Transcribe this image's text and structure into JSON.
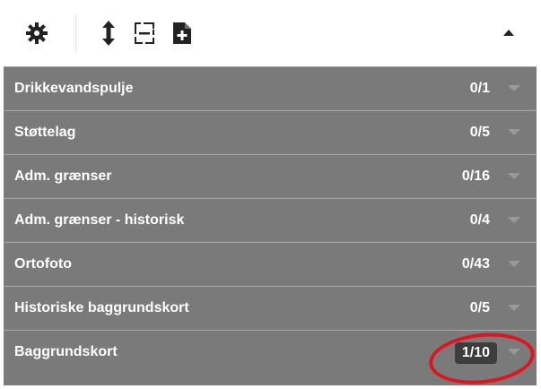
{
  "toolbar": {
    "icons": [
      "gear-icon",
      "expand-vertical-icon",
      "collapse-frame-icon",
      "add-document-icon",
      "chevron-up-icon"
    ]
  },
  "layers": [
    {
      "name": "Drikkevandspulje",
      "count": "0/1",
      "highlighted": false
    },
    {
      "name": "Støttelag",
      "count": "0/5",
      "highlighted": false
    },
    {
      "name": "Adm. grænser",
      "count": "0/16",
      "highlighted": false
    },
    {
      "name": "Adm. grænser - historisk",
      "count": "0/4",
      "highlighted": false
    },
    {
      "name": "Ortofoto",
      "count": "0/43",
      "highlighted": false
    },
    {
      "name": "Historiske baggrundskort",
      "count": "0/5",
      "highlighted": false
    },
    {
      "name": "Baggrundskort",
      "count": "1/10",
      "highlighted": true
    }
  ],
  "colors": {
    "row_background": "#7a7a7a",
    "row_divider": "#a6a6a6",
    "text": "#ffffff",
    "highlight_badge": "#3d3d3d",
    "annotation": "#e0141e"
  }
}
